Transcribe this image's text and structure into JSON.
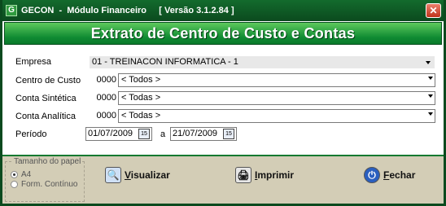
{
  "window": {
    "title": "GECON  -  Módulo Financeiro     [ Versão 3.1.2.84 ]",
    "close_glyph": "✕"
  },
  "banner": {
    "title": "Extrato de Centro de Custo e Contas"
  },
  "form": {
    "empresa": {
      "label": "Empresa",
      "value": "01 - TREINACON INFORMATICA - 1"
    },
    "centro_custo": {
      "label": "Centro de Custo",
      "code": "0000",
      "value": "< Todos >"
    },
    "conta_sintetica": {
      "label": "Conta Sintética",
      "code": "0000",
      "value": "< Todas >"
    },
    "conta_analitica": {
      "label": "Conta Analítica",
      "code": "0000",
      "value": "< Todas >"
    },
    "periodo": {
      "label": "Período",
      "start": "01/07/2009",
      "separator": "a",
      "end": "21/07/2009",
      "calendar_glyph": "15"
    }
  },
  "paper_size": {
    "title": "Tamanho do papel",
    "options": [
      "A4",
      "Form. Contínuo"
    ],
    "selected": "A4"
  },
  "buttons": {
    "visualizar": {
      "mnemonic": "V",
      "rest": "isualizar",
      "icon": "magnifier-icon"
    },
    "imprimir": {
      "mnemonic": "I",
      "rest": "mprimir",
      "icon": "printer-icon"
    },
    "fechar": {
      "mnemonic": "F",
      "rest": "echar",
      "icon": "power-icon"
    }
  },
  "colors": {
    "title_bar": "#0b4a1e",
    "banner": "#0f8a32",
    "bottom_panel": "#d3cdb6"
  }
}
